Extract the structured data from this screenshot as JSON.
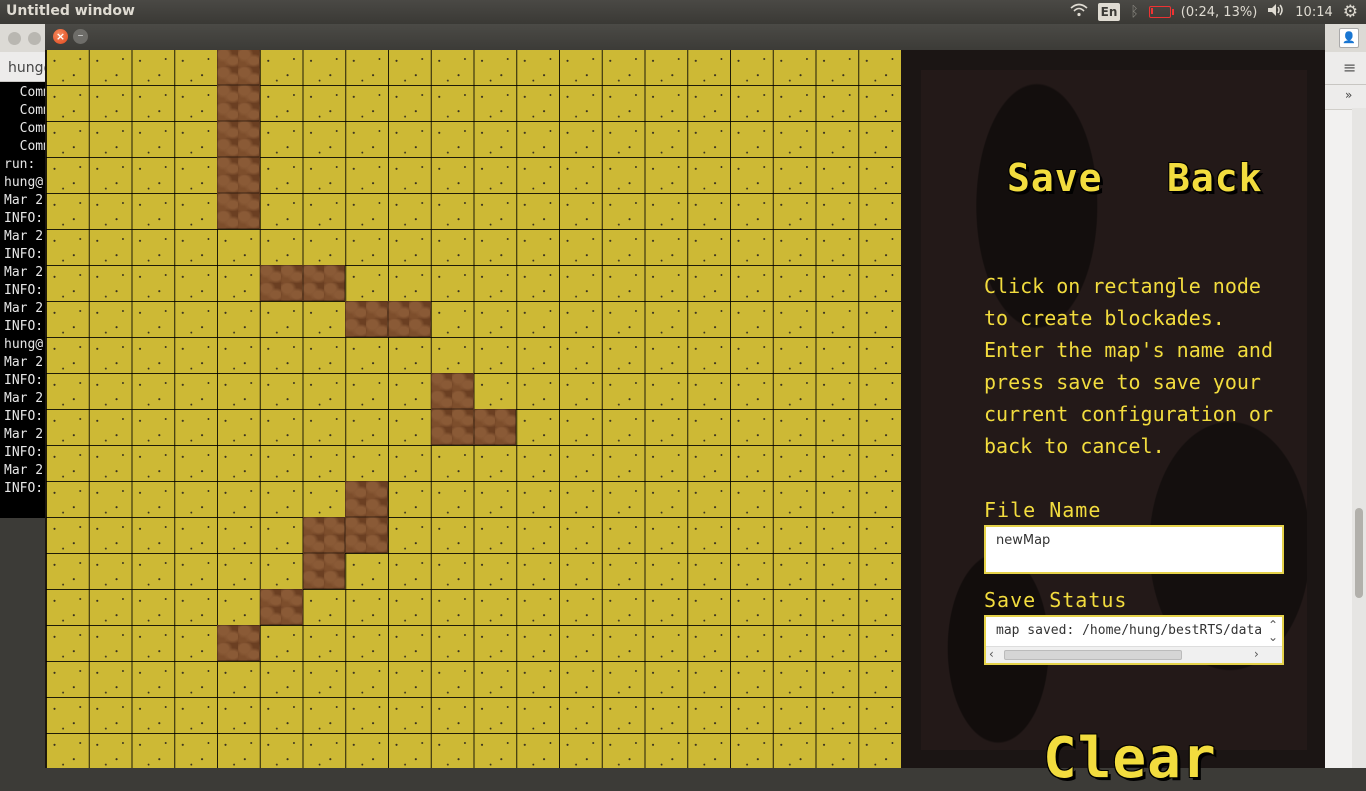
{
  "top_panel": {
    "title": "Untitled window",
    "keyboard_layout": "En",
    "battery_text": "(0:24, 13%)",
    "battery_level": 0.13,
    "clock": "10:14"
  },
  "terminal": {
    "tab_label": "hung@",
    "lines": [
      "  Comm",
      "  Comm",
      "  Comm",
      "  Comm",
      "run:",
      "hung@",
      "Mar 2",
      "INFO:",
      "Mar 2",
      "INFO:",
      "Mar 2",
      "INFO:",
      "Mar 2",
      "INFO:",
      "hung@",
      "Mar 2",
      "INFO:",
      "Mar 2",
      "INFO:",
      "Mar 2",
      "INFO:",
      "Mar 2",
      "INFO:"
    ]
  },
  "side_panel": {
    "save_label": "Save",
    "back_label": "Back",
    "instructions": "Click on rectangle node\nto create blockades.\nEnter the map's name and\npress save to save your\ncurrent configuration or\nback to cancel.",
    "file_name_label": "File Name",
    "file_name_value": "newMap",
    "save_status_label": "Save Status",
    "save_status_value": "map saved: /home/hung/bestRTS/data",
    "clear_label": "Clear"
  },
  "colors": {
    "grass": "#cdb935",
    "blockade": "#6b3f22",
    "text_accent": "#f2dc3e",
    "panel_bg": "#1b1514"
  },
  "map": {
    "columns": 20,
    "rows": 20,
    "blockades": [
      {
        "col": 4,
        "row": 0
      },
      {
        "col": 4,
        "row": 1
      },
      {
        "col": 4,
        "row": 2
      },
      {
        "col": 4,
        "row": 3
      },
      {
        "col": 4,
        "row": 4
      },
      {
        "col": 5,
        "row": 6
      },
      {
        "col": 6,
        "row": 6
      },
      {
        "col": 7,
        "row": 7
      },
      {
        "col": 8,
        "row": 7
      },
      {
        "col": 9,
        "row": 9
      },
      {
        "col": 9,
        "row": 10
      },
      {
        "col": 10,
        "row": 10
      },
      {
        "col": 7,
        "row": 12
      },
      {
        "col": 7,
        "row": 13
      },
      {
        "col": 6,
        "row": 13
      },
      {
        "col": 6,
        "row": 14
      },
      {
        "col": 5,
        "row": 15
      },
      {
        "col": 4,
        "row": 16
      }
    ]
  }
}
